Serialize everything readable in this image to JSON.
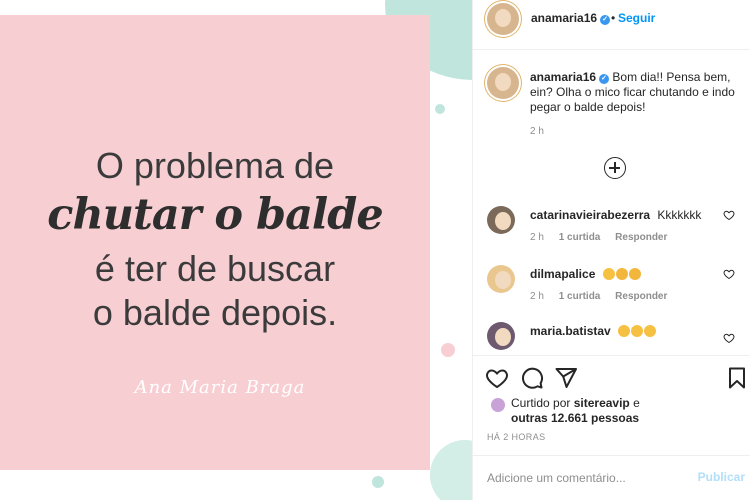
{
  "post": {
    "quote_line1": "O problema de",
    "quote_script": "chutar o balde",
    "quote_line3": "é ter de buscar",
    "quote_line4": "o balde depois.",
    "signature": "Ana Maria Braga"
  },
  "header": {
    "username": "anamaria16",
    "verified_icon": "verified-badge-icon",
    "separator": "•",
    "follow_label": "Seguir",
    "more_label": "···"
  },
  "caption": {
    "username": "anamaria16",
    "text": "Bom dia!! Pensa bem, ein? Olha o mico ficar chutando e indo pegar o balde depois!",
    "time": "2 h"
  },
  "comments": [
    {
      "username": "catarinavieirabezerra",
      "text": "Kkkkkkk",
      "time": "2 h",
      "likes": "1 curtida",
      "reply": "Responder"
    },
    {
      "username": "dilmapalice",
      "text": "",
      "time": "2 h",
      "likes": "1 curtida",
      "reply": "Responder"
    },
    {
      "username": "maria.batistav",
      "text": "",
      "time": "",
      "likes": "",
      "reply": ""
    }
  ],
  "actions": {
    "liked_by_prefix": "Curtido por",
    "liked_by_user": "sitereavip",
    "liked_by_connector": "e",
    "others_text": "outras 12.661 pessoas",
    "post_time": "HÁ 2 HORAS"
  },
  "comment_box": {
    "placeholder": "Adicione um comentário...",
    "publish_label": "Publicar"
  },
  "colors": {
    "accent": "#0095f6",
    "pink_card": "#f7cfd3",
    "mint": "#bfe5dd",
    "publish_disabled": "#b2dffc"
  }
}
